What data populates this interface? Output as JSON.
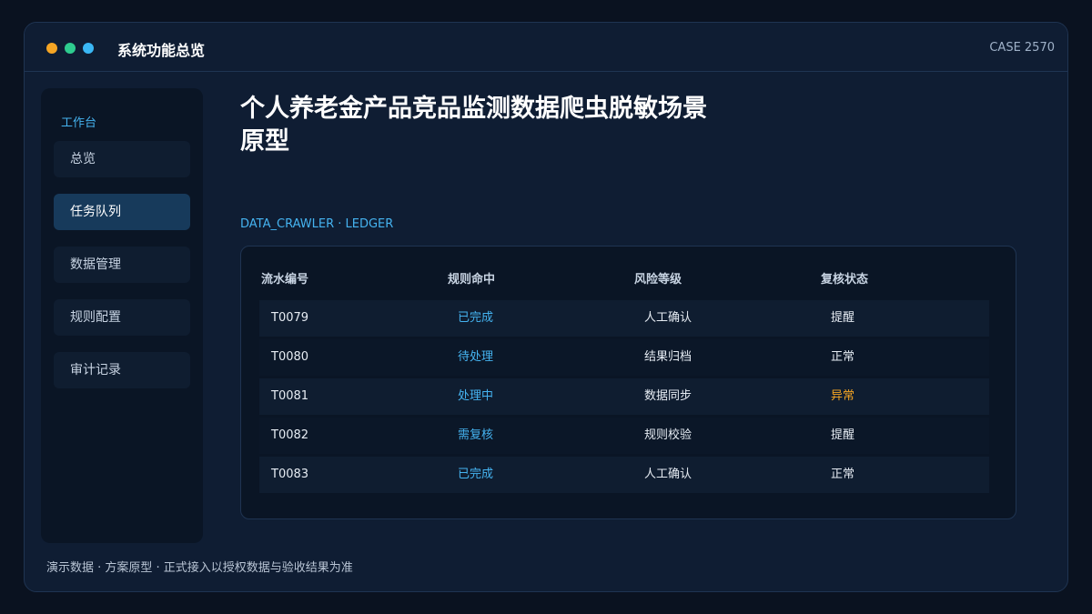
{
  "window": {
    "title": "系统功能总览",
    "case_id": "CASE 2570",
    "traffic_lights": [
      "#f5a524",
      "#2ecc8f",
      "#3ab7f5"
    ]
  },
  "sidebar": {
    "section_label": "工作台",
    "items": [
      {
        "label": "总览",
        "active": false
      },
      {
        "label": "任务队列",
        "active": true
      },
      {
        "label": "数据管理",
        "active": false
      },
      {
        "label": "规则配置",
        "active": false
      },
      {
        "label": "审计记录",
        "active": false
      }
    ]
  },
  "main": {
    "title": "个人养老金产品竞品监测数据爬虫脱敏场景原型",
    "ledger_label": "DATA_CRAWLER · LEDGER",
    "table": {
      "headers": [
        "流水编号",
        "规则命中",
        "风险等级",
        "复核状态"
      ],
      "rows": [
        [
          "T0079",
          "已完成",
          "人工确认",
          "提醒"
        ],
        [
          "T0080",
          "待处理",
          "结果归档",
          "正常"
        ],
        [
          "T0081",
          "处理中",
          "数据同步",
          "异常"
        ],
        [
          "T0082",
          "需复核",
          "规则校验",
          "提醒"
        ],
        [
          "T0083",
          "已完成",
          "人工确认",
          "正常"
        ]
      ]
    }
  },
  "footer": {
    "note": "演示数据 · 方案原型 · 正式接入以授权数据与验收结果为准"
  },
  "colors": {
    "accent": "#45b3f0",
    "warning": "#f5a524",
    "active_nav": "#173a5b"
  }
}
